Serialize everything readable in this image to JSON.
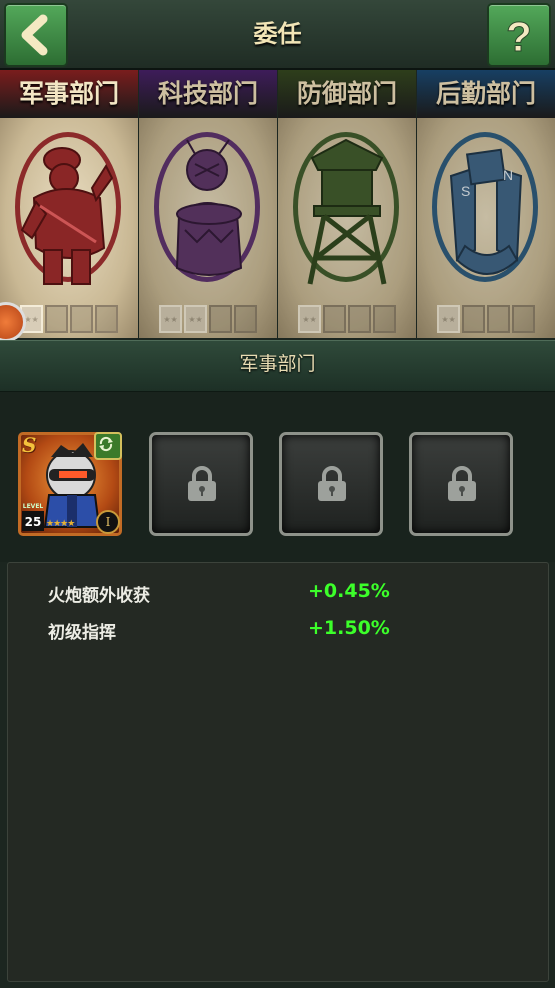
{
  "header": {
    "title": "委任",
    "back_icon": "chevron-left-icon",
    "help_icon": "question-mark-icon"
  },
  "departments": [
    {
      "label": "军事部门",
      "tab_color": "#7a1d1d",
      "oval_color": "#8c2a2a",
      "art_icon": "soldier-icon",
      "selected": true,
      "filled_slots": 1,
      "total_slots": 4
    },
    {
      "label": "科技部门",
      "tab_color": "#3e1c5a",
      "oval_color": "#5c2f6e",
      "art_icon": "scientist-machine-icon",
      "selected": false,
      "filled_slots": 2,
      "total_slots": 4
    },
    {
      "label": "防御部门",
      "tab_color": "#2e3e1b",
      "oval_color": "#3e5a2a",
      "art_icon": "watchtower-icon",
      "selected": false,
      "filled_slots": 1,
      "total_slots": 4
    },
    {
      "label": "后勤部门",
      "tab_color": "#173f63",
      "oval_color": "#2a5a7e",
      "art_icon": "magnet-icon",
      "selected": false,
      "filled_slots": 1,
      "total_slots": 4
    }
  ],
  "section": {
    "title": "军事部门"
  },
  "commanders": {
    "active": {
      "rank": "S",
      "level_label": "LEVEL",
      "level": "25",
      "stars": "★★★★",
      "tier": "I"
    },
    "locked_count": 3
  },
  "bonuses": [
    {
      "name": "火炮额外收获",
      "value": "+0.45%"
    },
    {
      "name": "初级指挥",
      "value": "+1.50%"
    }
  ],
  "colors": {
    "bonus_green": "#3cff2a",
    "title_gold": "#f2e5b6"
  }
}
